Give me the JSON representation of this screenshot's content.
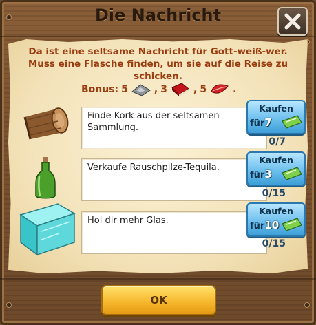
{
  "dialog": {
    "title": "Die Nachricht",
    "close_icon": "close-x-icon",
    "message": "Da ist eine seltsame Nachricht für Gott-weiß-wer. Muss eine Flasche finden, um sie auf die Reise zu schicken.",
    "bonus": {
      "label": "Bonus:",
      "items": [
        {
          "amount": "5",
          "icon": "silver-coin-pile-icon",
          "suffix": ","
        },
        {
          "amount": "3",
          "icon": "red-book-icon",
          "suffix": ","
        },
        {
          "amount": "5",
          "icon": "red-leaf-icon",
          "suffix": "."
        }
      ]
    },
    "tasks": [
      {
        "icon": "cork-icon",
        "text": "Finde Kork aus der seltsamen Sammlung.",
        "progress": "0/7",
        "buy_label": "Kaufen",
        "buy_prefix": "für",
        "buy_price": "7",
        "price_icon": "ticket-icon"
      },
      {
        "icon": "green-bottle-icon",
        "text": "Verkaufe Rauschpilze-Tequila.",
        "progress": "0/15",
        "buy_label": "Kaufen",
        "buy_prefix": "für",
        "buy_price": "3",
        "price_icon": "ticket-icon"
      },
      {
        "icon": "glass-cube-icon",
        "text": "Hol dir mehr Glas.",
        "progress": "0/15",
        "buy_label": "Kaufen",
        "buy_prefix": "für",
        "buy_price": "10",
        "price_icon": "ticket-icon"
      }
    ],
    "ok_label": "OK"
  },
  "colors": {
    "accent_text": "#9a3d10",
    "button_blue": "#6fc0ee",
    "ok_yellow": "#f5b52a",
    "wood": "#7a5231"
  }
}
